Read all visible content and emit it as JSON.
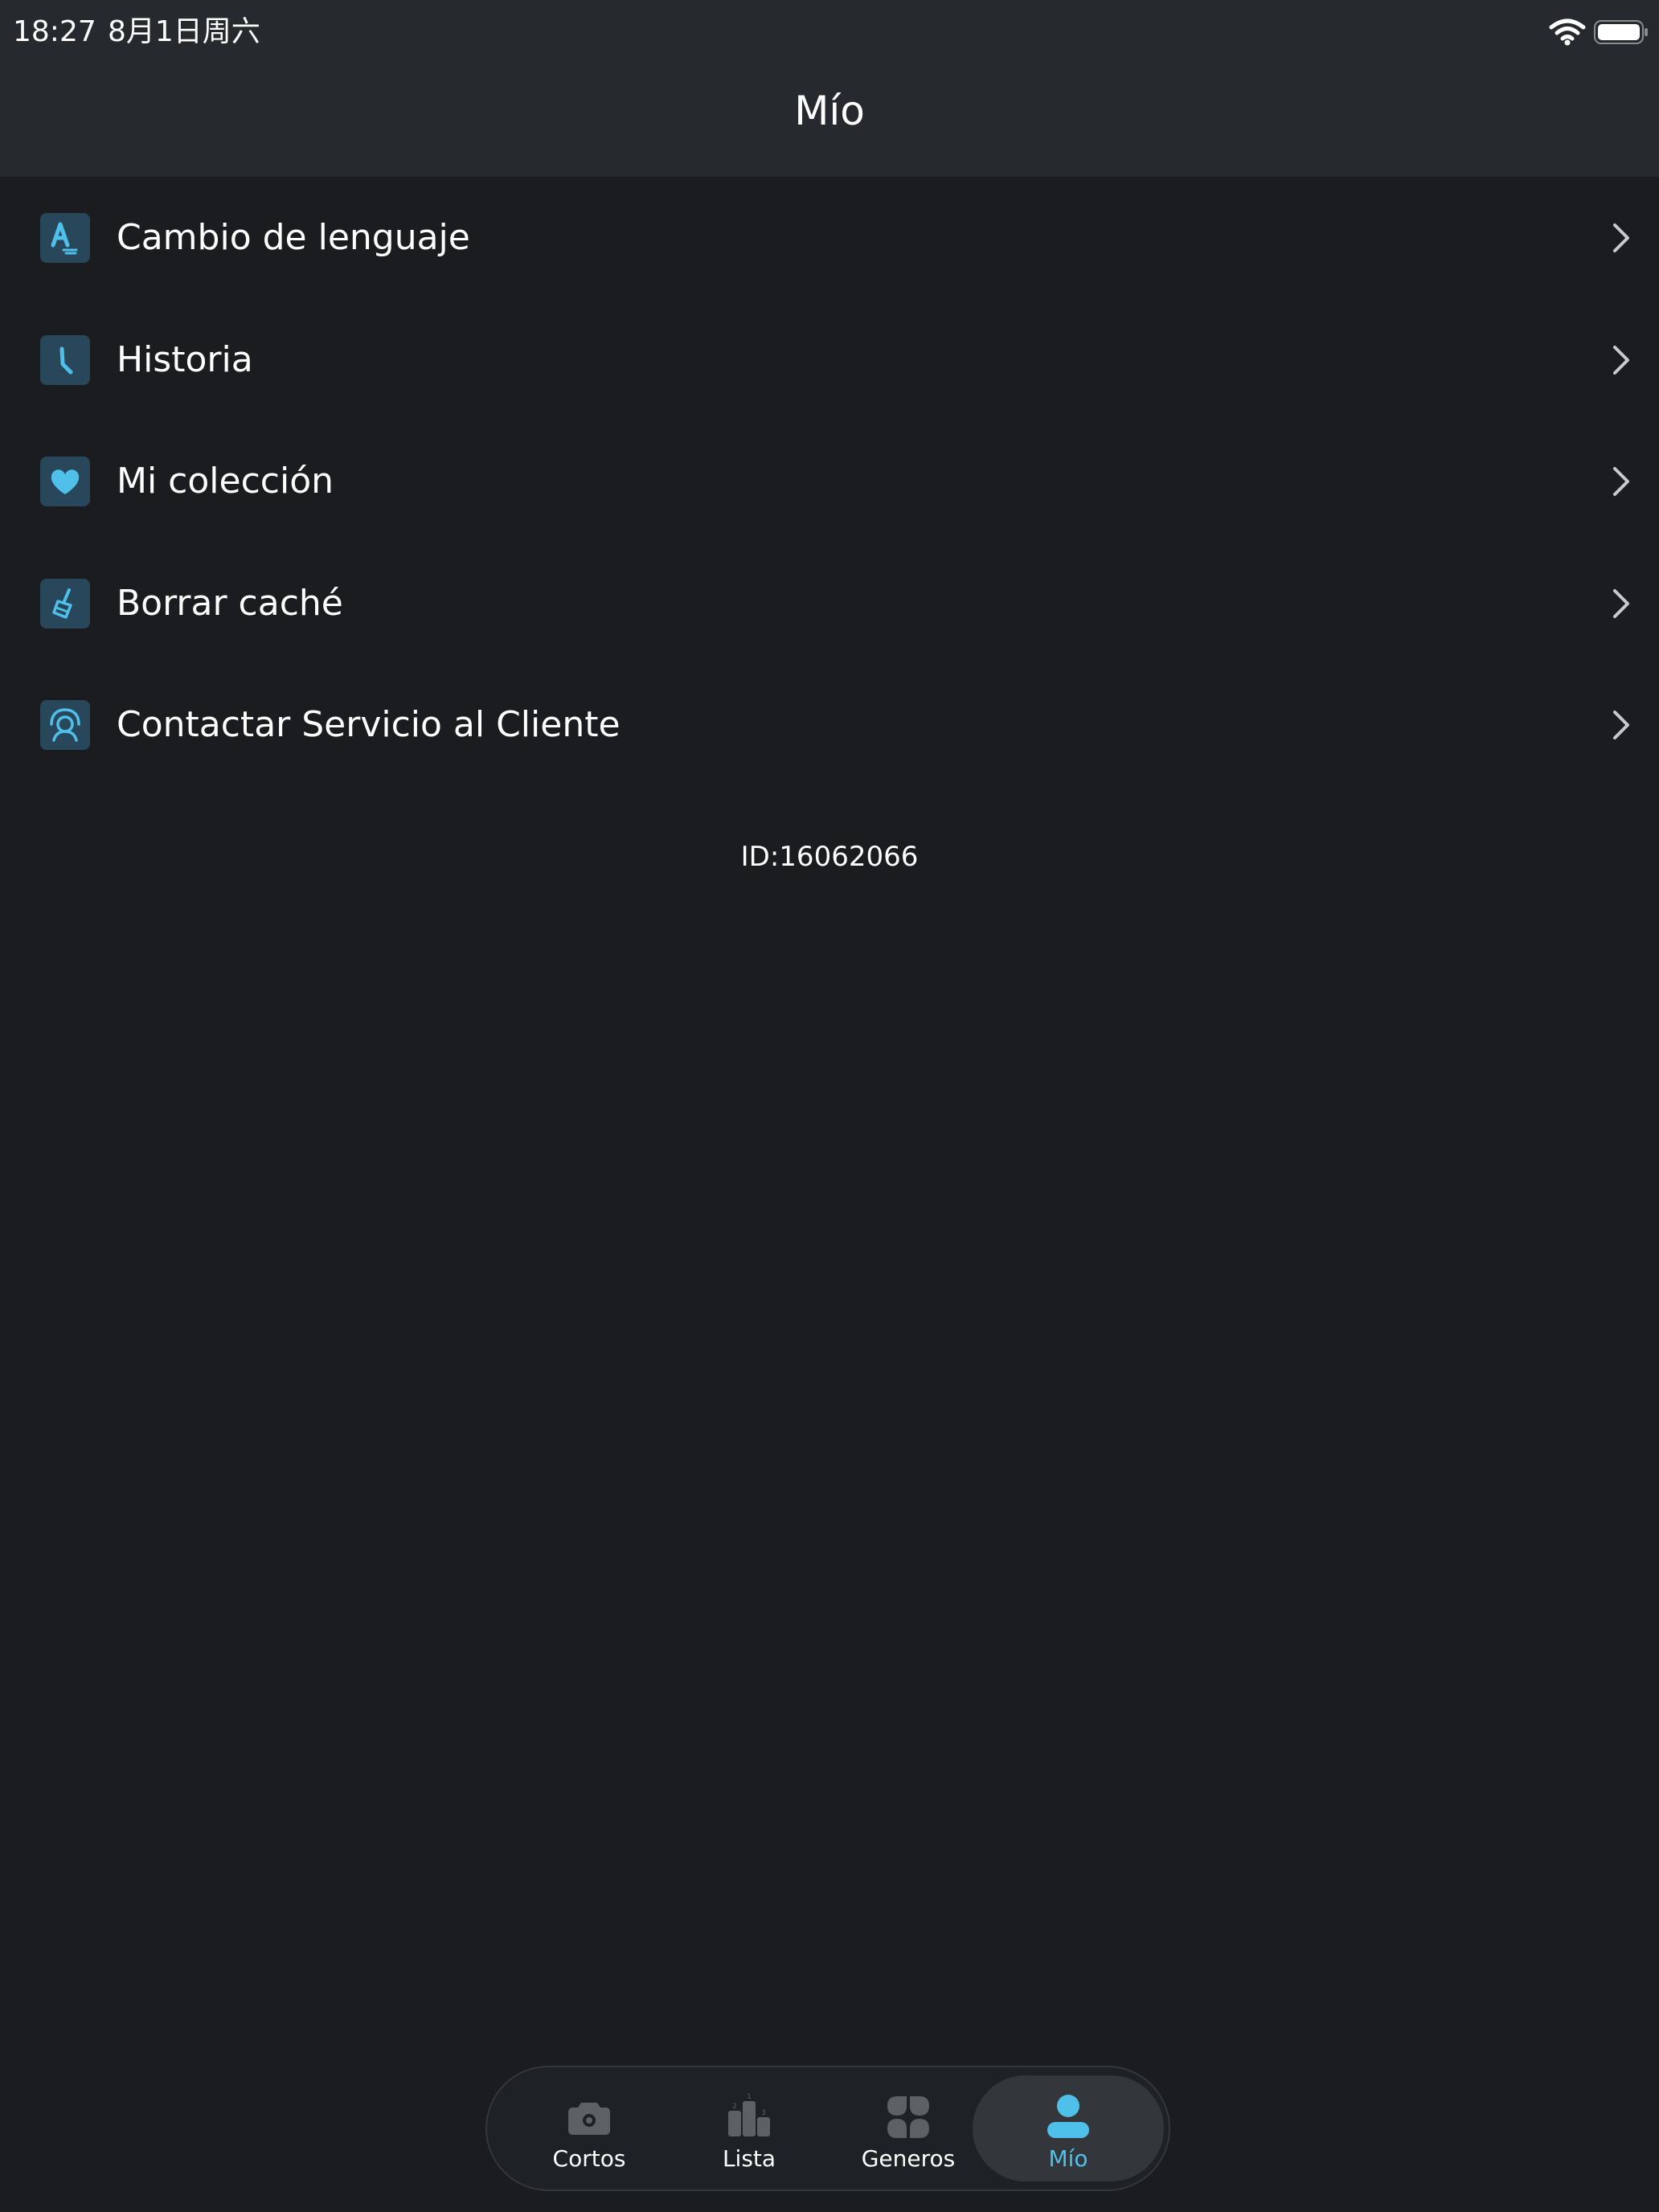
{
  "status_bar": {
    "time": "18:27",
    "date": "8月1日周六"
  },
  "header": {
    "title": "Mío"
  },
  "menu": {
    "items": [
      {
        "label": "Cambio de lenguaje",
        "icon": "language-icon"
      },
      {
        "label": "Historia",
        "icon": "clock-icon"
      },
      {
        "label": "Mi colección",
        "icon": "heart-icon"
      },
      {
        "label": "Borrar caché",
        "icon": "brush-icon"
      },
      {
        "label": "Contactar Servicio al Cliente",
        "icon": "headset-icon"
      }
    ]
  },
  "user": {
    "id_text": "ID:16062066"
  },
  "tab_bar": {
    "tabs": [
      {
        "label": "Cortos",
        "icon": "camera-icon",
        "active": false
      },
      {
        "label": "Lista",
        "icon": "podium-icon",
        "active": false
      },
      {
        "label": "Generos",
        "icon": "grid-icon",
        "active": false
      },
      {
        "label": "Mío",
        "icon": "user-icon",
        "active": true
      }
    ]
  },
  "colors": {
    "background": "#1a1c1f",
    "header_background": "#26292e",
    "accent": "#4fc0ea",
    "icon_tile": "#28475a",
    "inactive_tab_icon": "#5c6166"
  }
}
